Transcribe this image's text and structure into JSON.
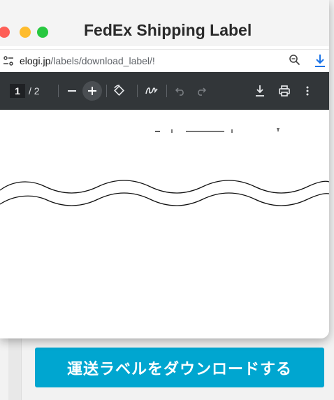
{
  "window": {
    "title": "FedEx Shipping Label"
  },
  "urlbar": {
    "domain": "elogi.jp",
    "path": "/labels/download_label/!"
  },
  "pdf_toolbar": {
    "current_page": "1",
    "page_total": "/ 2"
  },
  "page": {
    "download_button_label": "運送ラベルをダウンロードする"
  },
  "colors": {
    "accent_button": "#00a6d0",
    "toolbar_bg": "#323639",
    "traffic_red": "#fe5f57",
    "traffic_yellow": "#febc2e",
    "traffic_green": "#28c840",
    "download_icon": "#1a73e8"
  },
  "icons": [
    "site-info-icon",
    "zoom-icon",
    "download-icon",
    "zoom-out-icon",
    "zoom-in-icon",
    "rotate-icon",
    "annotate-icon",
    "undo-icon",
    "redo-icon",
    "pdf-download-icon",
    "print-icon",
    "more-icon"
  ]
}
